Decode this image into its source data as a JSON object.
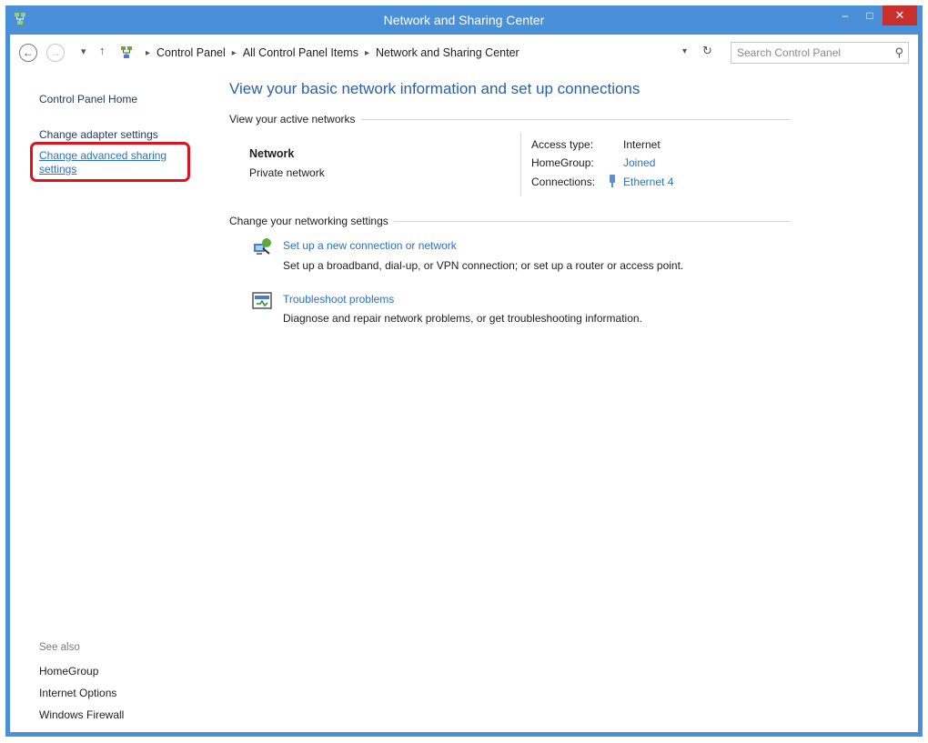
{
  "window": {
    "title": "Network and Sharing Center",
    "minimize_label": "–",
    "maximize_label": "□",
    "close_label": "✕"
  },
  "navigation": {
    "breadcrumb": [
      "Control Panel",
      "All Control Panel Items",
      "Network and Sharing Center"
    ],
    "search_placeholder": "Search Control Panel"
  },
  "sidebar": {
    "home": "Control Panel Home",
    "adapter": "Change adapter settings",
    "advanced": "Change advanced sharing settings",
    "see_also_label": "See also",
    "see_also": [
      "HomeGroup",
      "Internet Options",
      "Windows Firewall"
    ]
  },
  "main": {
    "title": "View your basic network information and set up connections",
    "active_networks_heading": "View your active networks",
    "network": {
      "name": "Network",
      "type": "Private network",
      "access_type_label": "Access type:",
      "access_type_value": "Internet",
      "homegroup_label": "HomeGroup:",
      "homegroup_value": "Joined",
      "connections_label": "Connections:",
      "connections_value": "Ethernet 4"
    },
    "settings_heading": "Change your networking settings",
    "tasks": [
      {
        "title": "Set up a new connection or network",
        "description": "Set up a broadband, dial-up, or VPN connection; or set up a router or access point."
      },
      {
        "title": "Troubleshoot problems",
        "description": "Diagnose and repair network problems, or get troubleshooting information."
      }
    ]
  },
  "colors": {
    "titlebar": "#4a90d8",
    "close_button": "#c9302c",
    "link": "#2a6fce",
    "highlight": "#e0121e"
  }
}
